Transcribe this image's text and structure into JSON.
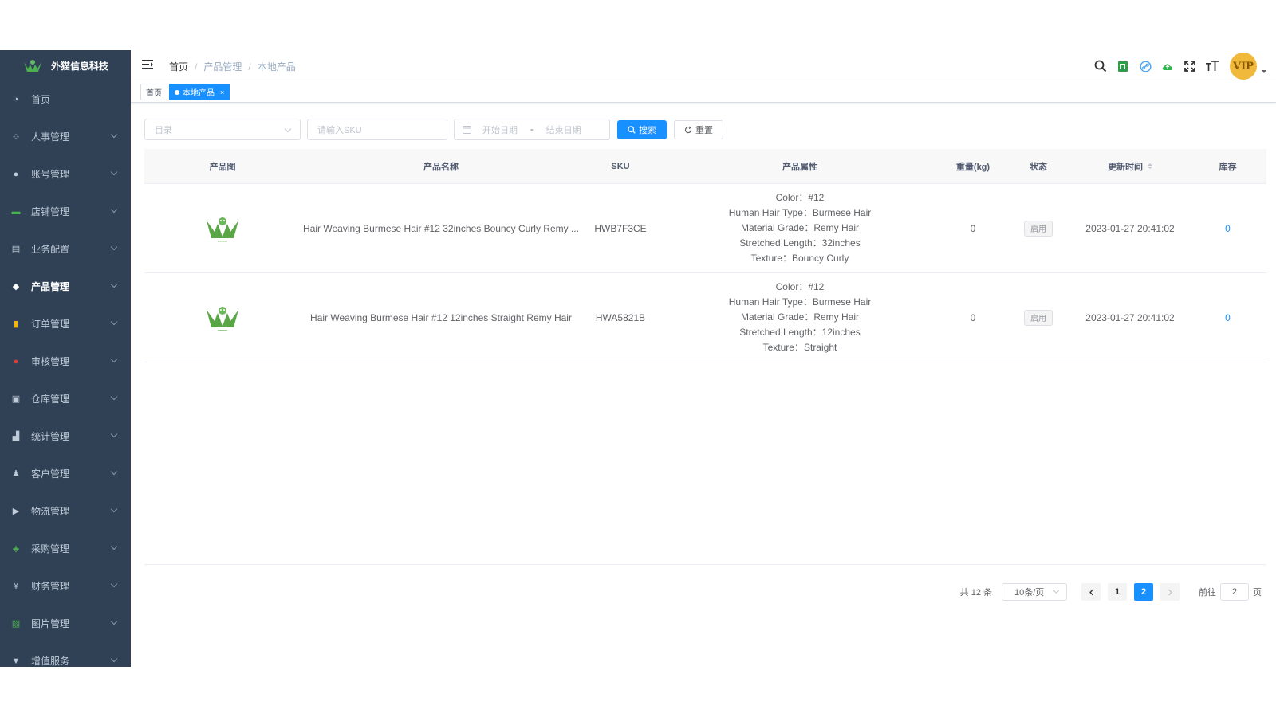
{
  "brand": {
    "name": "外猫信息科技"
  },
  "sidebar": {
    "items": [
      {
        "label": "首页",
        "icon": "dashboard-icon",
        "has_children": false
      },
      {
        "label": "人事管理",
        "icon": "peoples-icon",
        "has_children": true
      },
      {
        "label": "账号管理",
        "icon": "user-icon",
        "has_children": true
      },
      {
        "label": "店铺管理",
        "icon": "shop-icon",
        "has_children": true
      },
      {
        "label": "业务配置",
        "icon": "document-icon",
        "has_children": true
      },
      {
        "label": "产品管理",
        "icon": "box-icon",
        "has_children": true,
        "active": true
      },
      {
        "label": "订单管理",
        "icon": "order-icon",
        "has_children": true
      },
      {
        "label": "审核管理",
        "icon": "audit-user-icon",
        "has_children": true
      },
      {
        "label": "仓库管理",
        "icon": "warehouse-icon",
        "has_children": true
      },
      {
        "label": "统计管理",
        "icon": "bar-chart-icon",
        "has_children": true
      },
      {
        "label": "客户管理",
        "icon": "customer-icon",
        "has_children": true
      },
      {
        "label": "物流管理",
        "icon": "truck-icon",
        "has_children": true
      },
      {
        "label": "采购管理",
        "icon": "shield-icon",
        "has_children": true
      },
      {
        "label": "财务管理",
        "icon": "yen-icon",
        "has_children": true
      },
      {
        "label": "图片管理",
        "icon": "image-icon",
        "has_children": true
      },
      {
        "label": "增值服务",
        "icon": "cart-icon",
        "has_children": true
      }
    ]
  },
  "breadcrumb": [
    "首页",
    "产品管理",
    "本地产品"
  ],
  "toolbar_icons": [
    "search-icon",
    "excel-icon",
    "link-icon",
    "cloud-icon",
    "fullscreen-icon",
    "font-size-icon"
  ],
  "user": {
    "avatar_text": "VIP"
  },
  "tags": [
    {
      "label": "首页",
      "active": false
    },
    {
      "label": "本地产品",
      "active": true,
      "close": "×"
    }
  ],
  "filters": {
    "catalog_placeholder": "目录",
    "sku_placeholder": "请输入SKU",
    "start_date_placeholder": "开始日期",
    "date_sep": "-",
    "end_date_placeholder": "结束日期",
    "search_label": "搜索",
    "reset_label": "重置"
  },
  "table": {
    "headers": [
      "产品图",
      "产品名称",
      "SKU",
      "产品属性",
      "重量(kg)",
      "状态",
      "更新时间",
      "库存"
    ],
    "rows": [
      {
        "name": "Hair Weaving Burmese Hair #12 32inches Bouncy Curly Remy ...",
        "sku": "HWB7F3CE",
        "attrs": [
          "Color：#12",
          "Human Hair Type：Burmese Hair",
          "Material Grade：Remy Hair",
          "Stretched Length：32inches",
          "Texture：Bouncy Curly"
        ],
        "weight": "0",
        "status": "启用",
        "updated": "2023-01-27 20:41:02",
        "stock": "0"
      },
      {
        "name": "Hair Weaving Burmese Hair #12 12inches Straight Remy Hair",
        "sku": "HWA5821B",
        "attrs": [
          "Color：#12",
          "Human Hair Type：Burmese Hair",
          "Material Grade：Remy Hair",
          "Stretched Length：12inches",
          "Texture：Straight"
        ],
        "weight": "0",
        "status": "启用",
        "updated": "2023-01-27 20:41:02",
        "stock": "0"
      }
    ]
  },
  "pagination": {
    "total_label": "共 12 条",
    "page_size": "10条/页",
    "pages": [
      "1",
      "2"
    ],
    "current": "2",
    "goto_label": "前往",
    "goto_value": "2",
    "page_suffix": "页"
  },
  "colors": {
    "sidebar_bg": "#304156",
    "accent": "#1890ff",
    "logo_green": "#4caf50"
  }
}
